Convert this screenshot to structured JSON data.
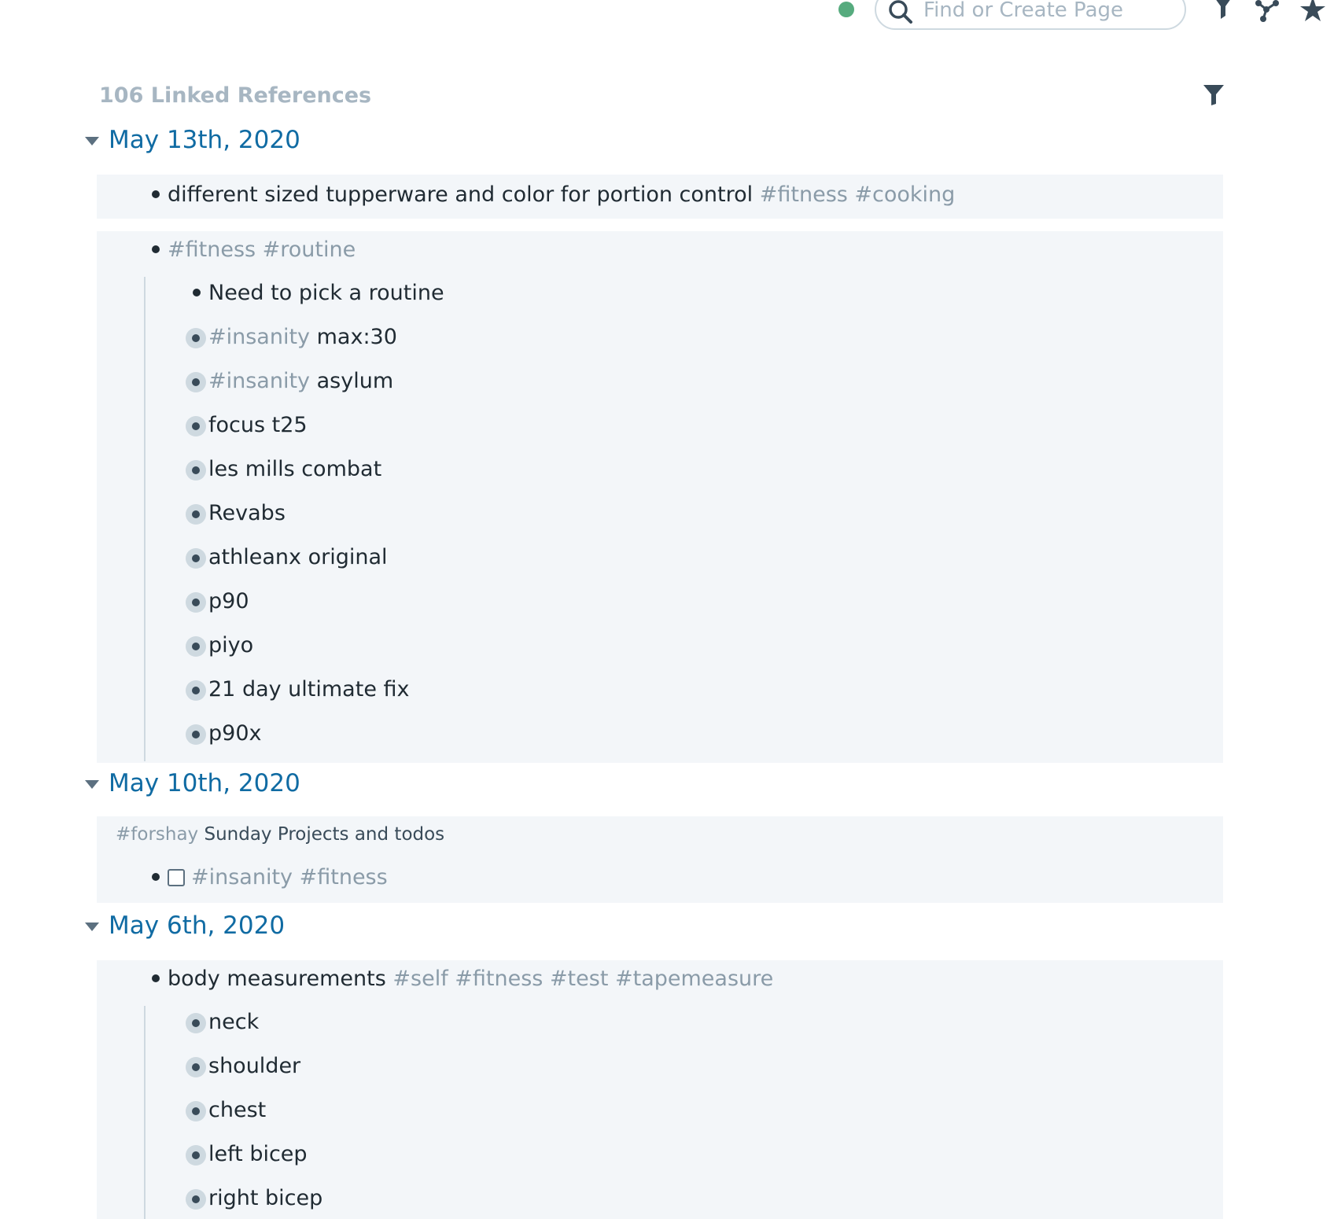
{
  "topbar": {
    "search_placeholder": "Find or Create Page",
    "icons": [
      "search-icon",
      "filter-icon",
      "graph-icon",
      "star-icon"
    ]
  },
  "linked_refs": {
    "title": "106 Linked References"
  },
  "groups": [
    {
      "date": "May 13th, 2020",
      "blocks": [
        {
          "text": "different sized tupperware and color for portion control",
          "tags": "#fitness #cooking"
        },
        {
          "tags": "#fitness #routine",
          "children": [
            {
              "text": "Need to pick a routine"
            },
            {
              "tag": "#insanity",
              "text": "max:30"
            },
            {
              "tag": "#insanity",
              "text": "asylum"
            },
            {
              "text": "focus t25"
            },
            {
              "text": "les mills combat"
            },
            {
              "text": "Revabs"
            },
            {
              "text": "athleanx original"
            },
            {
              "text": "p90"
            },
            {
              "text": "piyo"
            },
            {
              "text": "21 day ultimate fix"
            },
            {
              "text": "p90x"
            }
          ]
        }
      ]
    },
    {
      "date": "May 10th, 2020",
      "breadcrumb": {
        "tag": "#forshay",
        "text": "Sunday Projects and todos"
      },
      "blocks": [
        {
          "tags": "#insanity #fitness",
          "checkbox": true
        }
      ]
    },
    {
      "date": "May 6th, 2020",
      "blocks": [
        {
          "text": "body measurements",
          "tags": "#self #fitness #test #tapemeasure",
          "children": [
            {
              "text": "neck"
            },
            {
              "text": "shoulder"
            },
            {
              "text": "chest"
            },
            {
              "text": "left bicep"
            },
            {
              "text": "right bicep"
            }
          ]
        }
      ]
    }
  ]
}
